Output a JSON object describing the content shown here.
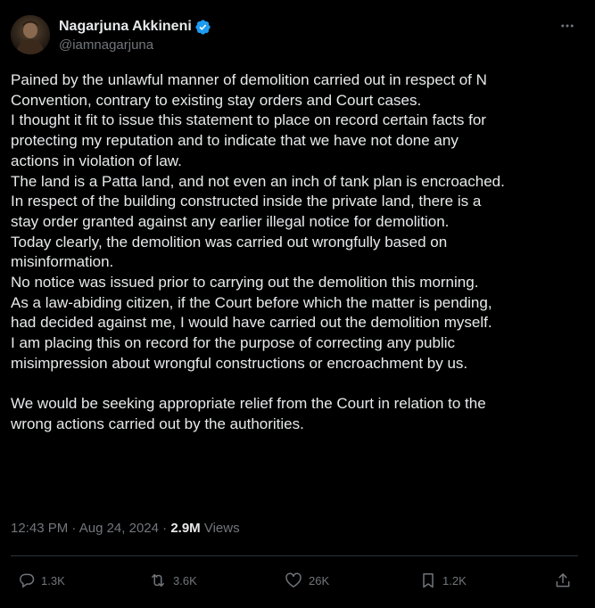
{
  "author": {
    "display_name": "Nagarjuna Akkineni",
    "handle": "@iamnagarjuna",
    "verified": true,
    "avatar_icon": "avatar-photo"
  },
  "more_icon": "more-dots-icon",
  "tweet": {
    "lines": [
      "Pained by the unlawful manner of demolition carried out in respect of N",
      "Convention, contrary to existing stay orders and Court cases.",
      "I thought it fit to issue this statement to place on record certain facts for",
      "protecting my reputation and to indicate that we have not done any",
      "actions in violation of law.",
      "The land is a Patta land, and not even an inch of tank plan is encroached.",
      "In respect of the building constructed inside the private land, there is a",
      "stay order granted against any earlier illegal notice for demolition.",
      "Today clearly, the demolition was carried out wrongfully based on",
      "misinformation.",
      "No notice was issued prior to carrying out the demolition this morning.",
      "As a law-abiding citizen, if the Court before which the matter is pending,",
      "had decided against me, I would have carried out the demolition myself.",
      "I am placing this on record for the purpose of correcting any public",
      "misimpression about wrongful constructions or encroachment by us.",
      "",
      "We would be seeking appropriate relief from the Court in relation to the",
      "wrong actions carried out by the authorities."
    ]
  },
  "meta": {
    "time": "12:43 PM",
    "separator": "·",
    "date": "Aug 24, 2024",
    "views_count": "2.9M",
    "views_label": "Views"
  },
  "actions": {
    "replies": "1.3K",
    "reposts": "3.6K",
    "likes": "26K",
    "bookmarks": "1.2K"
  },
  "colors": {
    "background": "#000000",
    "text": "#e7e9ea",
    "muted": "#71767b",
    "verified_badge": "#1d9bf0",
    "divider": "#2f3336"
  }
}
